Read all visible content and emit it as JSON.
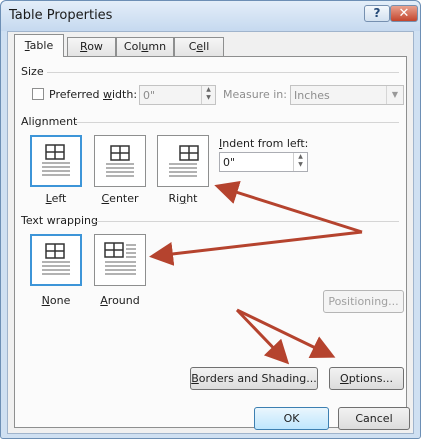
{
  "window": {
    "title": "Table Properties"
  },
  "titlebar": {
    "help_label": "?",
    "close_label": "✕"
  },
  "tabs": [
    {
      "label": "Table",
      "mnemonic": "T",
      "rest": "able"
    },
    {
      "label": "Row",
      "mnemonic": "R",
      "rest": "ow"
    },
    {
      "label": "Column",
      "mnemonic": "U",
      "pre": "Col",
      "rest": "mn"
    },
    {
      "label": "Cell",
      "mnemonic": "E",
      "pre": "C",
      "rest": "ll"
    }
  ],
  "size": {
    "heading": "Size",
    "preferred_width_pre": "Preferred ",
    "preferred_width_mn": "w",
    "preferred_width_post": "idth:",
    "preferred_width_value": "0\"",
    "measure_in_label": "Measure in:",
    "measure_in_value": "Inches"
  },
  "alignment": {
    "heading": "Alignment",
    "options": [
      {
        "mn": "L",
        "rest": "eft",
        "selected": true
      },
      {
        "mn": "C",
        "rest": "enter",
        "selected": false
      },
      {
        "pre": "Ri",
        "mn": "g",
        "rest": "ht",
        "selected": false
      }
    ],
    "indent_pre": "",
    "indent_mn": "I",
    "indent_post": "ndent from left:",
    "indent_value": "0\""
  },
  "text_wrapping": {
    "heading": "Text wrapping",
    "options": [
      {
        "mn": "N",
        "rest": "one",
        "selected": true
      },
      {
        "mn": "A",
        "rest": "round",
        "selected": false
      }
    ],
    "positioning_label": "Positioning..."
  },
  "buttons": {
    "borders_mn": "B",
    "borders_rest": "orders and Shading...",
    "options_mn": "O",
    "options_rest": "ptions...",
    "ok": "OK",
    "cancel": "Cancel"
  },
  "colors": {
    "annotation_arrow": "#b5432e",
    "selection": "#3d95d8"
  }
}
